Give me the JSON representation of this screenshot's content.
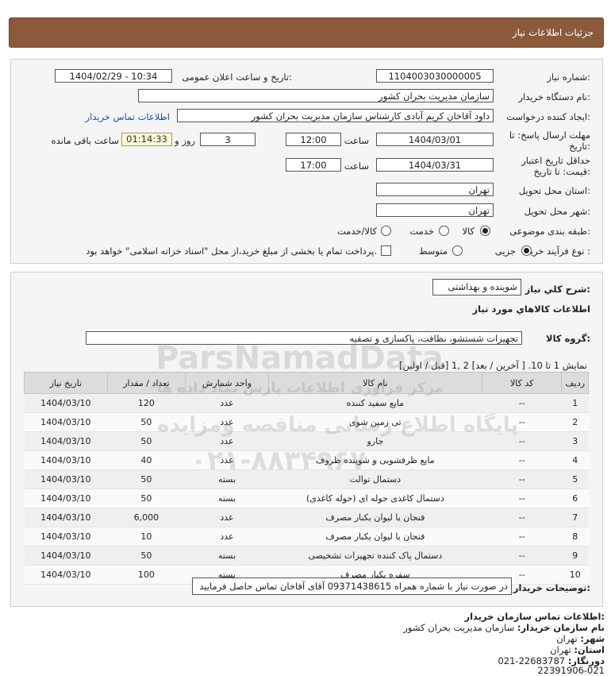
{
  "header": {
    "title": "جزئیات اطلاعات نیاز"
  },
  "info": {
    "need_number_label": "شماره نیاز:",
    "need_number": "1104003030000005",
    "announce_label": "تاریخ و ساعت اعلان عمومی:",
    "announce_value": "1404/02/29 - 10:34",
    "buyer_org_label": "نام دستگاه خریدار:",
    "buyer_org": "سازمان مدیریت بحران کشور",
    "creator_label": "ایجاد کننده درخواست:",
    "creator": "داود آقاخان کریم آبادی کارشناس سازمان مدیریت بحران کشور",
    "contact_link": "اطلاعات تماس خریدار",
    "deadline_label_1": "مهلت ارسال پاسخ: تا",
    "deadline_label_2": "تاریخ:",
    "deadline_date": "1404/03/01",
    "time_label": "ساعت",
    "deadline_time": "12:00",
    "days": "3",
    "days_label": "روز و",
    "remaining_time": "01:14:33",
    "remaining_label": "ساعت باقی مانده",
    "validity_label_1": "حداقل تاریخ اعتبار",
    "validity_label_2": "قیمت: تا تاریخ:",
    "validity_date": "1404/03/31",
    "validity_time": "17:00",
    "province_label": "استان محل تحویل:",
    "province": "تهران",
    "city_label": "شهر محل تحویل:",
    "city": "تهران",
    "category_label": "طبقه بندی موضوعی:",
    "category_options": [
      "کالا",
      "خدمت",
      "کالا/خدمت"
    ],
    "category_selected": "کالا",
    "process_label": "نوع فرآیند خرید :",
    "process_options": [
      "جزیی",
      "متوسط"
    ],
    "process_selected": "جزیی",
    "payment_note": "پرداخت تمام یا بخشی از مبلغ خرید،از محل \"اسناد خزانه اسلامی\" خواهد بود."
  },
  "needs": {
    "summary_label": "شرح کلي نياز:",
    "summary": "شوینده و بهداشتی",
    "goods_info_title": "اطلاعات کالاهاي مورد نياز",
    "group_label": "گروه کالا:",
    "group": "تجهیزات شستشو، نظافت، پاکسازی و تصفیه",
    "paging": "نمایش 1 تا 10. [ آخرین / بعد] 2 ,1 [قبل / اولین]",
    "columns": [
      "ردیف",
      "کد کالا",
      "نام کالا",
      "واحد شمارش",
      "تعداد / مقدار",
      "تاریخ نیاز"
    ],
    "rows": [
      [
        "1",
        "--",
        "مایع سفید کننده",
        "عدد",
        "120",
        "1404/03/10"
      ],
      [
        "2",
        "--",
        "تی زمین شوی",
        "عدد",
        "50",
        "1404/03/10"
      ],
      [
        "3",
        "--",
        "جارو",
        "عدد",
        "50",
        "1404/03/10"
      ],
      [
        "4",
        "--",
        "مایع ظرفشویی و شوینده ظروف",
        "عدد",
        "40",
        "1404/03/10"
      ],
      [
        "5",
        "--",
        "دستمال توالت",
        "بسته",
        "50",
        "1404/03/10"
      ],
      [
        "6",
        "--",
        "دستمال کاغذی حوله ای (حوله کاغذی)",
        "بسته",
        "50",
        "1404/03/10"
      ],
      [
        "7",
        "--",
        "فنجان یا لیوان یکبار مصرف",
        "عدد",
        "6,000",
        "1404/03/10"
      ],
      [
        "8",
        "--",
        "فنجان یا لیوان یکبار مصرف",
        "عدد",
        "10",
        "1404/03/10"
      ],
      [
        "9",
        "--",
        "دستمال پاک کننده تجهیزات تشخیصی",
        "بسته",
        "50",
        "1404/03/10"
      ],
      [
        "10",
        "--",
        "سفره یکبار مصرف",
        "بسته",
        "100",
        "1404/03/10"
      ]
    ],
    "buyer_notes_label": "توضیحات خریدار:",
    "buyer_notes": "در صورت نیاز با شماره همراه 09371438615 آقای آقاخان تماس حاصل فرمایید"
  },
  "contact": {
    "title": "اطلاعات تماس سازمان خریدار:",
    "org_label": "نام سازمان خریدار:",
    "org": "سازمان مدیریت بحران کشور",
    "city_label": "شهر:",
    "city": "تهران",
    "province_label": "استان:",
    "province": "تهران",
    "fax_label": "دورنگار:",
    "fax": "22683787-021",
    "phone": "22391906-021"
  },
  "watermark": {
    "brand": "ParsNamadData",
    "line1": "مرکز فراوری اطلاعات پارس نماد داده ها",
    "line2": "پایگاه اطلاع رسانی مناقصه ومزایده",
    "phone": "۰۲۱-۸۸۳۴۹۶۷۰"
  }
}
